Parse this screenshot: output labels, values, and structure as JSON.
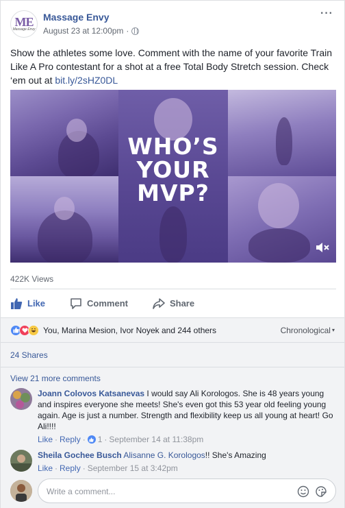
{
  "page": {
    "name": "Massage Envy",
    "logo_text": "ME",
    "logo_subtext": "Massage Envy",
    "timestamp": "August 23 at 12:00pm",
    "separator": "·",
    "more_label": "···"
  },
  "post": {
    "text": "Show the athletes some love. Comment with the name of your favorite Train Like A Pro contestant for a shot at a free Total Body Stretch session. Check ‘em out at ",
    "link": "bit.ly/2sHZ0DL"
  },
  "media": {
    "headline_line1": "WHO’S",
    "headline_line2": "YOUR",
    "headline_line3": "MVP?"
  },
  "views": "422K Views",
  "actions": {
    "like": "Like",
    "comment": "Comment",
    "share": "Share"
  },
  "reactions": {
    "summary": "You, Marina Mesion, Ivor Noyek and 244 others",
    "sort_label": "Chronological",
    "sort_caret": "▾"
  },
  "shares": "24 Shares",
  "comments": {
    "view_more": "View 21 more comments",
    "items": [
      {
        "author": "Joann Colovos Katsanevas",
        "text": " I would say Ali Korologos. She is 48 years young and inspires everyone she meets! She's even got this 53 year old feeling young again. Age is just a number. Strength and flexibility keep us all young at heart! Go Ali!!!!",
        "like": "Like",
        "reply": "Reply",
        "dot": "·",
        "like_count": "1",
        "time": "September 14 at 11:38pm"
      },
      {
        "author": "Sheila Gochee Busch",
        "mention": "Alisanne G. Korologos",
        "text": "!! She's Amazing",
        "like": "Like",
        "reply": "Reply",
        "dot": "·",
        "time": "September 15 at 3:42pm"
      }
    ],
    "write_placeholder": "Write a comment..."
  },
  "colors": {
    "link_blue": "#385898",
    "like_blue": "#4267b2",
    "media_purple": "#5a4994"
  }
}
